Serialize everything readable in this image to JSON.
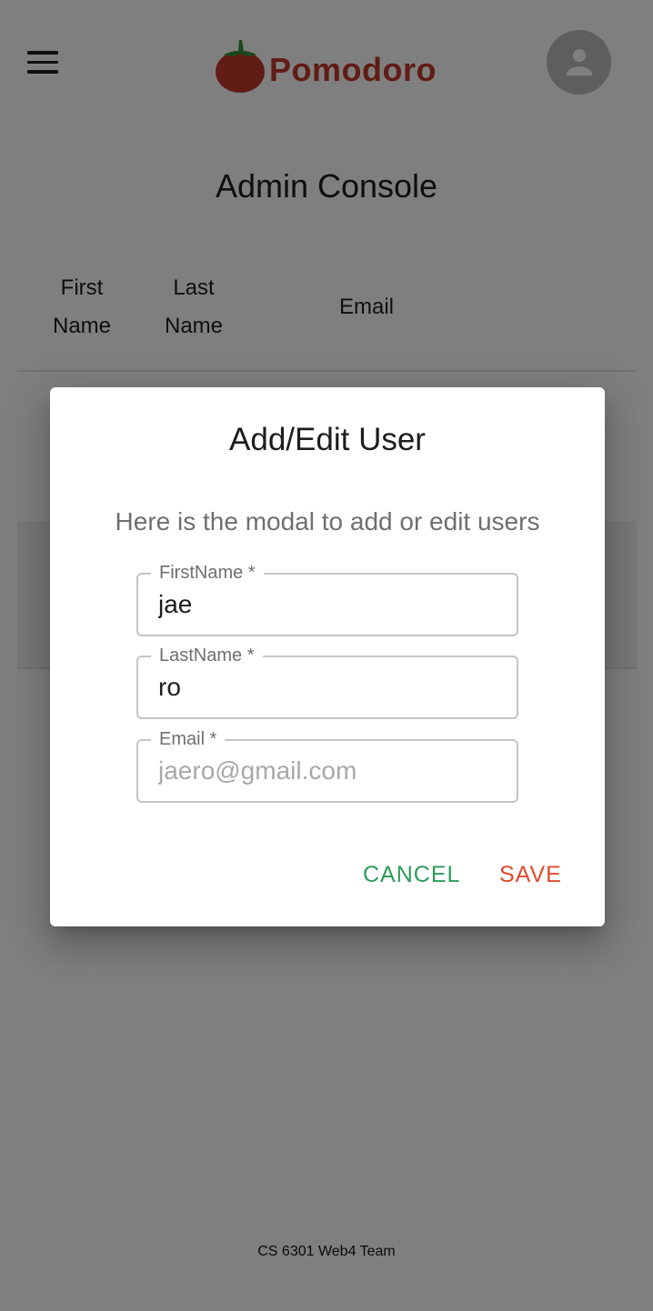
{
  "header": {
    "app_name": "Pomodoro",
    "menu_icon": "hamburger-menu-icon",
    "avatar_icon": "account-icon"
  },
  "page": {
    "title": "Admin Console"
  },
  "table": {
    "columns": [
      "First Name",
      "Last Name",
      "Email"
    ]
  },
  "modal": {
    "title": "Add/Edit User",
    "description": "Here is the modal to add or edit users",
    "fields": {
      "first_name": {
        "label": "FirstName *",
        "value": "jae"
      },
      "last_name": {
        "label": "LastName *",
        "value": "ro"
      },
      "email": {
        "label": "Email *",
        "value": "",
        "placeholder": "jaero@gmail.com"
      }
    },
    "cancel_label": "CANCEL",
    "save_label": "SAVE"
  },
  "footer": {
    "text": "CS 6301 Web4 Team"
  },
  "colors": {
    "brand": "#c0392b",
    "cancel": "#2e9b5a",
    "save": "#e04a2f",
    "overlay": "rgba(0,0,0,0.5)"
  }
}
